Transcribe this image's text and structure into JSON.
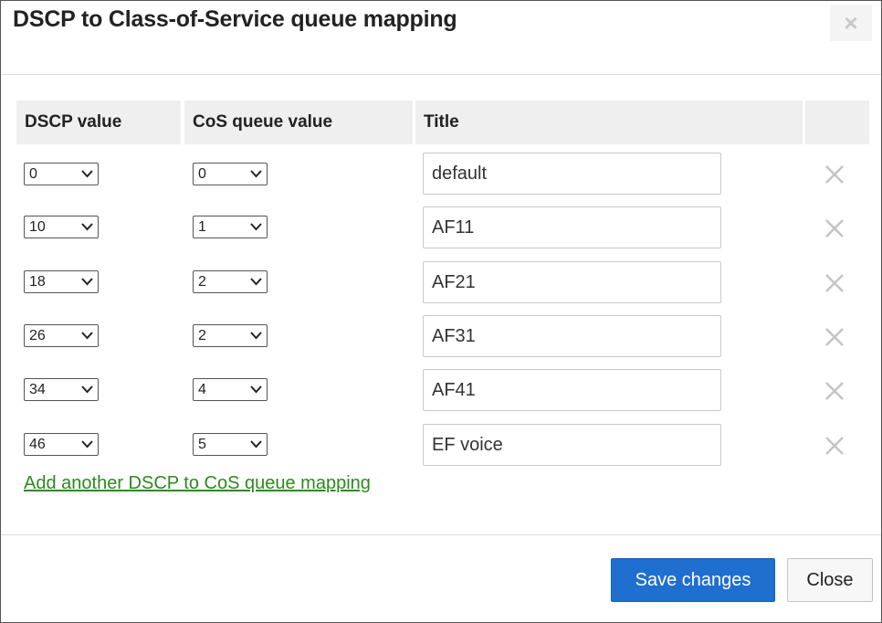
{
  "dialog": {
    "title": "DSCP to Class-of-Service queue mapping",
    "close_symbol": "×"
  },
  "table": {
    "headers": [
      "DSCP value",
      "CoS queue value",
      "Title"
    ],
    "rows": [
      {
        "dscp": "0",
        "cos": "0",
        "title": "default"
      },
      {
        "dscp": "10",
        "cos": "1",
        "title": "AF11"
      },
      {
        "dscp": "18",
        "cos": "2",
        "title": "AF21"
      },
      {
        "dscp": "26",
        "cos": "2",
        "title": "AF31"
      },
      {
        "dscp": "34",
        "cos": "4",
        "title": "AF41"
      },
      {
        "dscp": "46",
        "cos": "5",
        "title": "EF voice"
      }
    ],
    "row_action_icon": "remove-x-icon"
  },
  "add_link": "Add another DSCP to CoS queue mapping",
  "footer": {
    "save_label": "Save changes",
    "close_label": "Close"
  },
  "colors": {
    "primary": "#1f6fd1",
    "link": "#2b8a1d",
    "header_bg": "#efefef"
  }
}
